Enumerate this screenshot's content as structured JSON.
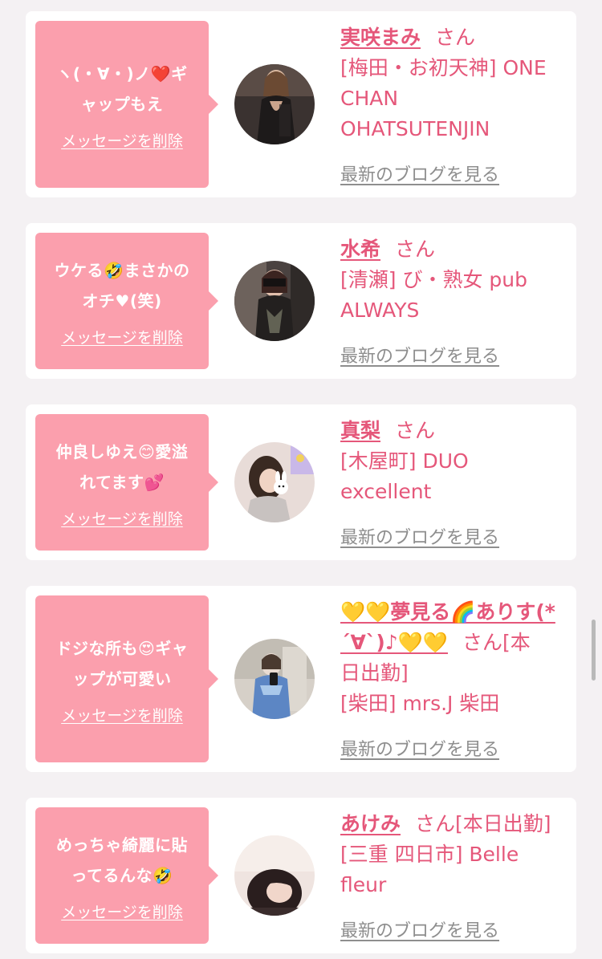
{
  "delete_label": "メッセージを削除",
  "blog_label": "最新のブログを見る",
  "san_label": "さん",
  "colors": {
    "bubble": "#fb9fad",
    "accent": "#e5577a",
    "link_gray": "#8e8e8e",
    "background": "#f4f1f3"
  },
  "cards": [
    {
      "message_1": "ヽ(・∀・)ノ❤️ギ",
      "message_2": "ャップもえ",
      "name": "実咲まみ",
      "suffix": "",
      "shop_1": "[梅田・お初天神] ONE",
      "shop_2": "CHAN",
      "shop_3": "OHATSUTENJIN"
    },
    {
      "message_1": "ウケる🤣まさかの",
      "message_2": "オチ♥(笑)",
      "name": "水希",
      "suffix": "",
      "shop_1": "[清瀬] び・熟女 pub",
      "shop_2": "ALWAYS"
    },
    {
      "message_1": "仲良しゆえ😊愛溢",
      "message_2": "れてます💕",
      "name": "真梨",
      "suffix": "",
      "shop_1": "[木屋町] DUO",
      "shop_2": "excellent"
    },
    {
      "message_1": "ドジな所も😍ギャ",
      "message_2": "ップが可愛い",
      "name_1": "💛💛夢見る🌈ありす(*",
      "name_2": "´∀`)♪💛💛",
      "suffix_1": "[本",
      "suffix_2": "日出勤]",
      "shop_1": "[柴田] mrs.J 柴田"
    },
    {
      "message_1": "めっちゃ綺麗に貼",
      "message_2": "ってるんな🤣",
      "name": "あけみ",
      "suffix": "[本日出勤]",
      "shop_1": "[三重 四日市] Belle",
      "shop_2": "fleur"
    }
  ]
}
